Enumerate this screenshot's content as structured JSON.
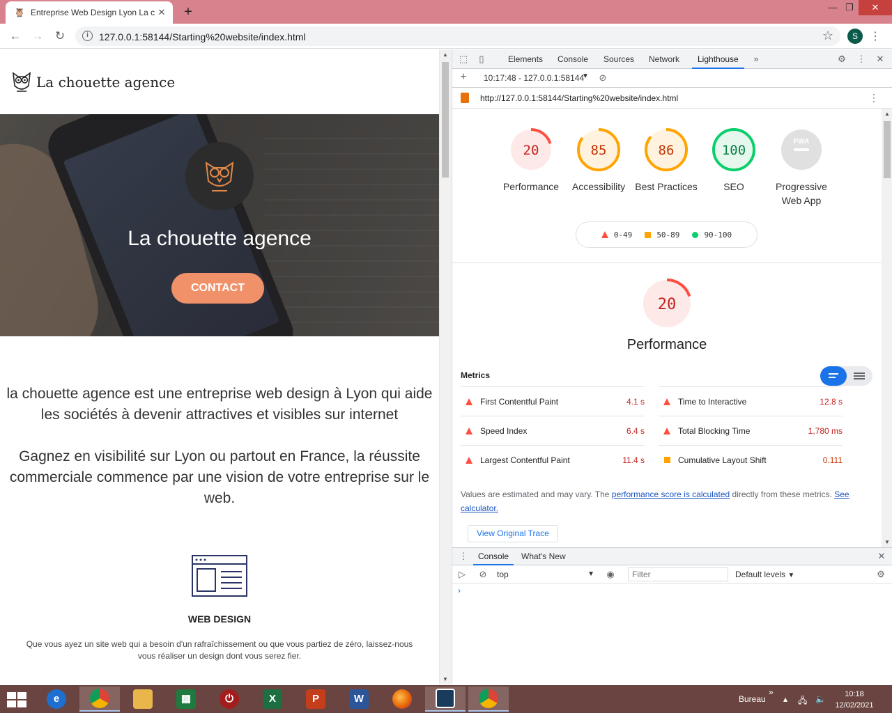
{
  "browser": {
    "tab_title": "Entreprise Web Design Lyon La c",
    "url": "127.0.0.1:58144/Starting%20website/index.html",
    "profile_initial": "S"
  },
  "site": {
    "brand": "La chouette agence",
    "hero_title": "La chouette agence",
    "cta_label": "CONTACT",
    "intro_1": "la chouette agence est une entreprise web design à Lyon qui aide les sociétés à devenir attractives et visibles sur internet",
    "intro_2": "Gagnez en visibilité sur Lyon ou partout en France, la réussite commerciale commence par une vision de votre entreprise sur le web.",
    "service_title": "WEB DESIGN",
    "service_text": "Que vous ayez un site web qui a besoin d'un rafraîchissement ou que vous partiez de zéro, laissez-nous vous réaliser un design dont vous serez fier."
  },
  "devtools": {
    "tabs": [
      "Elements",
      "Console",
      "Sources",
      "Network",
      "Lighthouse"
    ],
    "active_tab": "Lighthouse",
    "report_selector": "10:17:48 - 127.0.0.1:58144",
    "audited_url": "http://127.0.0.1:58144/Starting%20website/index.html",
    "scores": [
      {
        "label": "Performance",
        "score": 20,
        "color": "#ff4e42"
      },
      {
        "label": "Accessibility",
        "score": 85,
        "color": "#ffa400"
      },
      {
        "label": "Best Practices",
        "score": 86,
        "color": "#ffa400"
      },
      {
        "label": "SEO",
        "score": 100,
        "color": "#0cce6b"
      },
      {
        "label": "Progressive Web App",
        "score": null,
        "color": "#cccccc",
        "badge": "PWA"
      }
    ],
    "legend": {
      "low": "0-49",
      "mid": "50-89",
      "high": "90-100"
    },
    "performance": {
      "title": "Performance",
      "score": 20,
      "metrics_heading": "Metrics",
      "metrics": [
        {
          "name": "First Contentful Paint",
          "value": "4.1 s",
          "rating": "fail"
        },
        {
          "name": "Time to Interactive",
          "value": "12.8 s",
          "rating": "fail"
        },
        {
          "name": "Speed Index",
          "value": "6.4 s",
          "rating": "fail"
        },
        {
          "name": "Total Blocking Time",
          "value": "1,780 ms",
          "rating": "fail"
        },
        {
          "name": "Largest Contentful Paint",
          "value": "11.4 s",
          "rating": "fail"
        },
        {
          "name": "Cumulative Layout Shift",
          "value": "0.111",
          "rating": "average"
        }
      ],
      "note_prefix": "Values are estimated and may vary. The ",
      "note_link1": "performance score is calculated",
      "note_mid": " directly from these metrics. ",
      "note_link2": "See calculator.",
      "trace_button": "View Original Trace"
    },
    "drawer": {
      "tabs": [
        "Console",
        "What's New"
      ],
      "context": "top",
      "filter_placeholder": "Filter",
      "levels": "Default levels"
    }
  },
  "taskbar": {
    "tray_label": "Bureau",
    "time": "10:18",
    "date": "12/02/2021"
  }
}
